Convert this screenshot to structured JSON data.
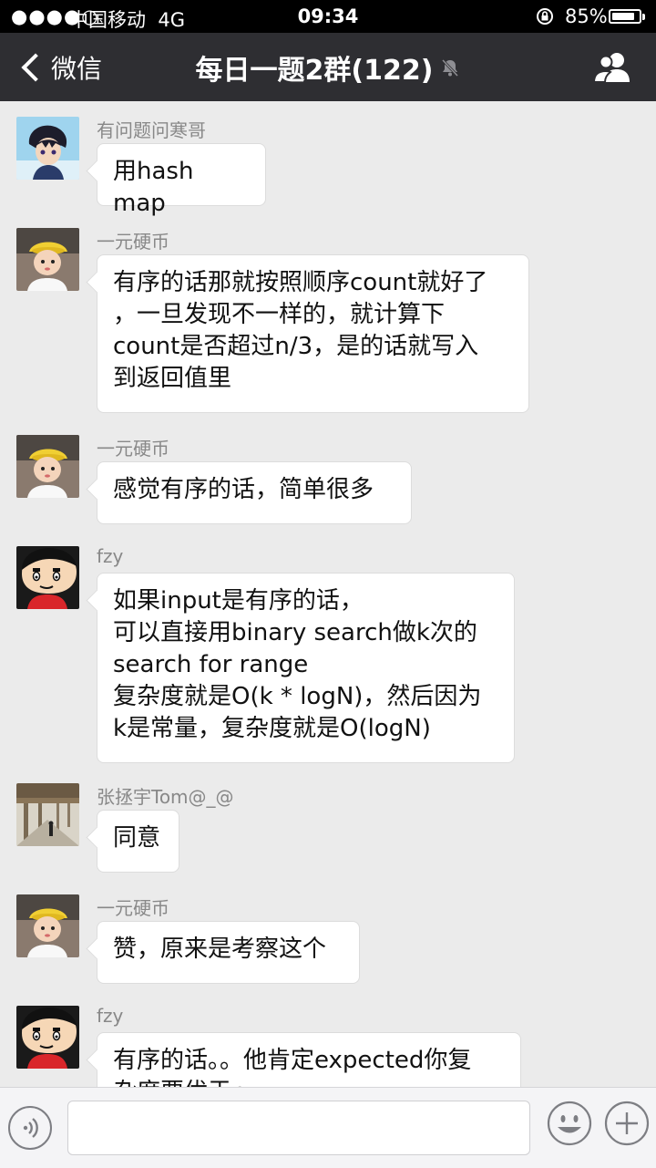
{
  "status_bar": {
    "signal": "●●●●○",
    "carrier": "中国移动",
    "network": "4G",
    "time": "09:34",
    "battery_percent": "85%",
    "battery_level": 0.85
  },
  "nav": {
    "back_label": "微信",
    "title": "每日一题2群(122)"
  },
  "messages": [
    {
      "sender": "有问题问寒哥",
      "text": "用hash map",
      "avatar": "anime-boy"
    },
    {
      "sender": "一元硬币",
      "text": "有序的话那就按照顺序count就好了\n，一旦发现不一样的，就计算下\ncount是否超过n/3，是的话就写入\n到返回值里",
      "avatar": "baby"
    },
    {
      "sender": "一元硬币",
      "text": "感觉有序的话，简单很多",
      "avatar": "baby"
    },
    {
      "sender": "fzy",
      "text": "如果input是有序的话，\n可以直接用binary search做k次的\nsearch for range\n复杂度就是O(k * logN)，然后因为\nk是常量，复杂度就是O(logN)",
      "avatar": "crayon-shin-chan"
    },
    {
      "sender": "张拯宇Tom@_@",
      "text": "同意",
      "avatar": "arcade-photo"
    },
    {
      "sender": "一元硬币",
      "text": "赞，原来是考察这个",
      "avatar": "baby"
    },
    {
      "sender": "fzy",
      "text": "有序的话。。他肯定expected你复\n杂度要优于n",
      "avatar": "crayon-shin-chan"
    }
  ],
  "colors": {
    "nav_bg": "#2e2e32",
    "chat_bg": "#ebebeb",
    "bubble_bg": "#ffffff"
  },
  "icons": {
    "mute": "bell-off-icon",
    "members": "group-members-icon",
    "voice": "voice-input-icon",
    "emoji": "emoji-icon",
    "plus": "plus-icon"
  }
}
